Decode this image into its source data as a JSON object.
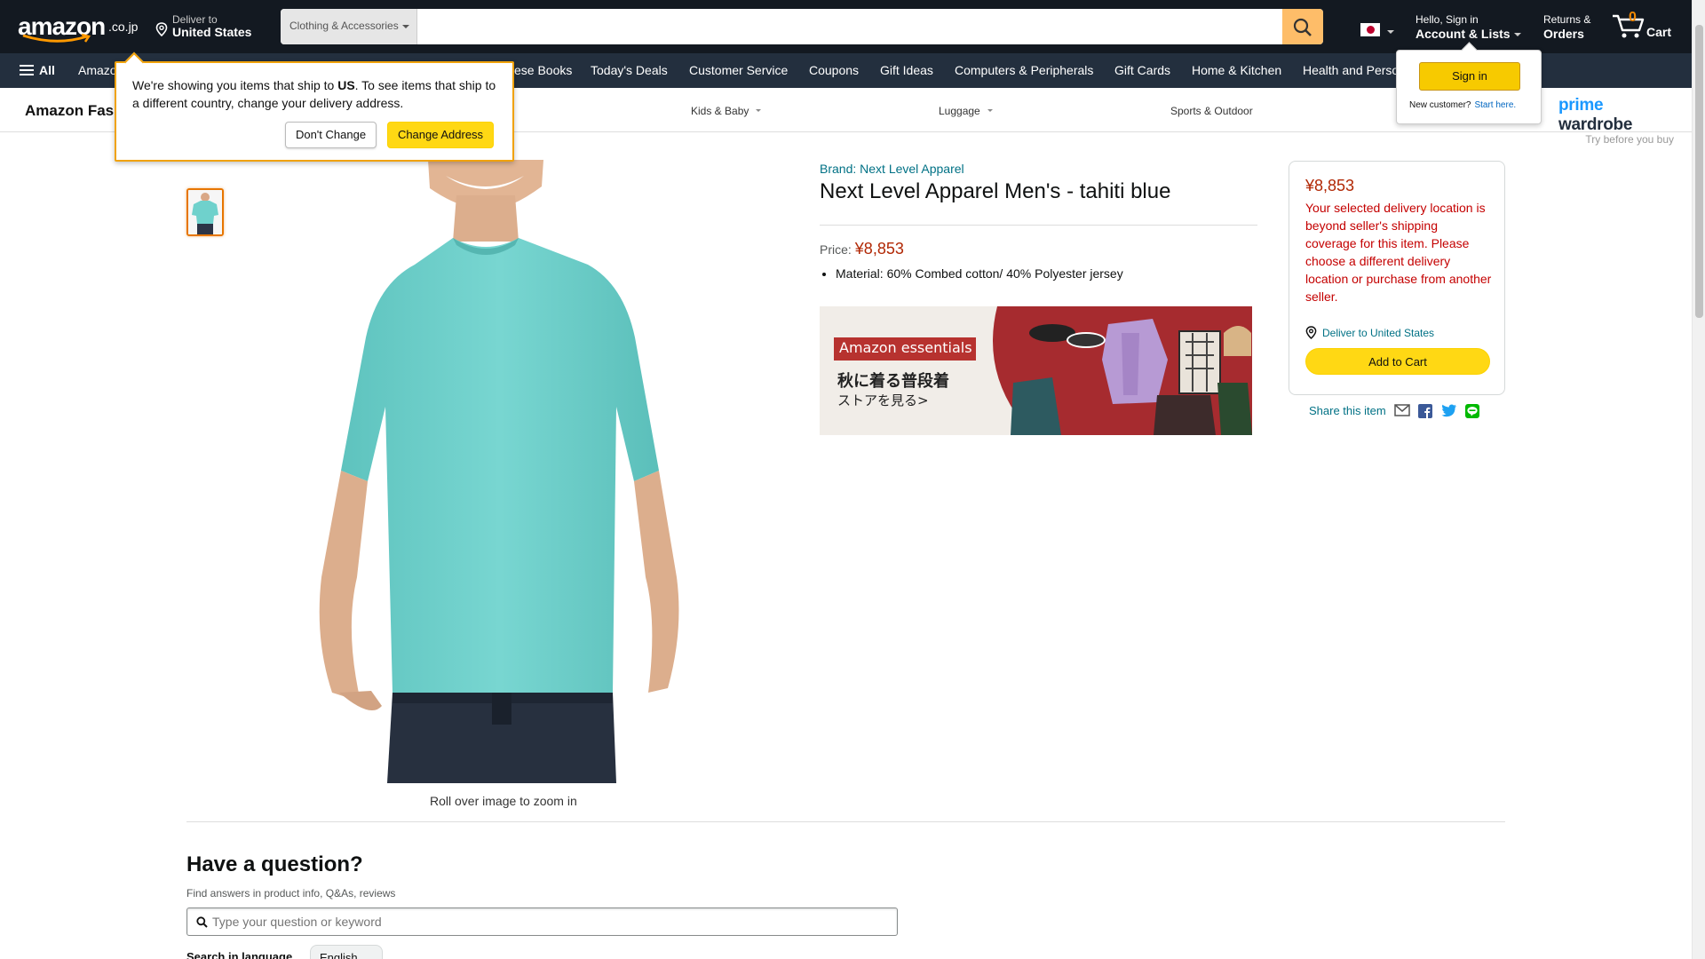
{
  "header": {
    "logo_text": "amazon",
    "logo_suffix": ".co.jp",
    "deliver_line1": "Deliver to",
    "deliver_line2": "United States",
    "search_category": "Clothing & Accessories",
    "search_placeholder": "",
    "account_line1": "Hello, Sign in",
    "account_line2": "Account & Lists",
    "returns_line1": "Returns &",
    "returns_line2": "Orders",
    "cart_count": "0",
    "cart_label": "Cart"
  },
  "nav": {
    "all_label": "All",
    "items": [
      "Amazon",
      "ese Books",
      "Today's Deals",
      "Customer Service",
      "Coupons",
      "Gift Ideas",
      "Computers & Peripherals",
      "Gift Cards",
      "Home & Kitchen",
      "Health and Perso"
    ]
  },
  "subnav": {
    "brand": "Amazon Fas",
    "items": [
      "Kids & Baby",
      "Luggage",
      "Sports & Outdoor"
    ]
  },
  "prime_wardrobe": {
    "title_prime": "prime",
    "title_word": "wardrobe",
    "tagline": "Try before you buy"
  },
  "ship_popover": {
    "message_pre": "We're showing you items that ship to ",
    "message_country": "US",
    "message_post": ". To see items that ship to a different country, change your delivery address.",
    "dont_change": "Don't Change",
    "change_address": "Change Address"
  },
  "signin_popover": {
    "button": "Sign in",
    "new_customer": "New customer?",
    "start_here": "Start here."
  },
  "product": {
    "brand_link": "Brand: Next Level Apparel",
    "title": "Next Level Apparel Men's - tahiti blue",
    "price_label": "Price:",
    "price": "¥8,853",
    "bullets": [
      "Material: 60% Combed cotton/ 40% Polyester jersey"
    ],
    "rollover": "Roll over image to zoom in"
  },
  "ad": {
    "badge": "Amazon essentials",
    "line1": "秋に着る普段着",
    "line2": "ストアを見る>"
  },
  "buybox": {
    "price": "¥8,853",
    "warning": "Your selected delivery location is beyond seller's shipping coverage for this item. Please choose a different delivery location or purchase from another seller.",
    "deliver_to": "Deliver to United States",
    "add_to_cart": "Add to Cart",
    "share_label": "Share this item"
  },
  "question": {
    "title": "Have a question?",
    "subtitle": "Find answers in product info, Q&As, reviews",
    "placeholder": "Type your question or keyword",
    "language_label": "Search in language",
    "language_value": "English"
  },
  "colors": {
    "header_bg": "#131921",
    "nav_bg": "#232f3e",
    "accent_orange": "#febd69",
    "price_red": "#b12704",
    "link_teal": "#007185",
    "shirt": "#6fd1cc"
  }
}
